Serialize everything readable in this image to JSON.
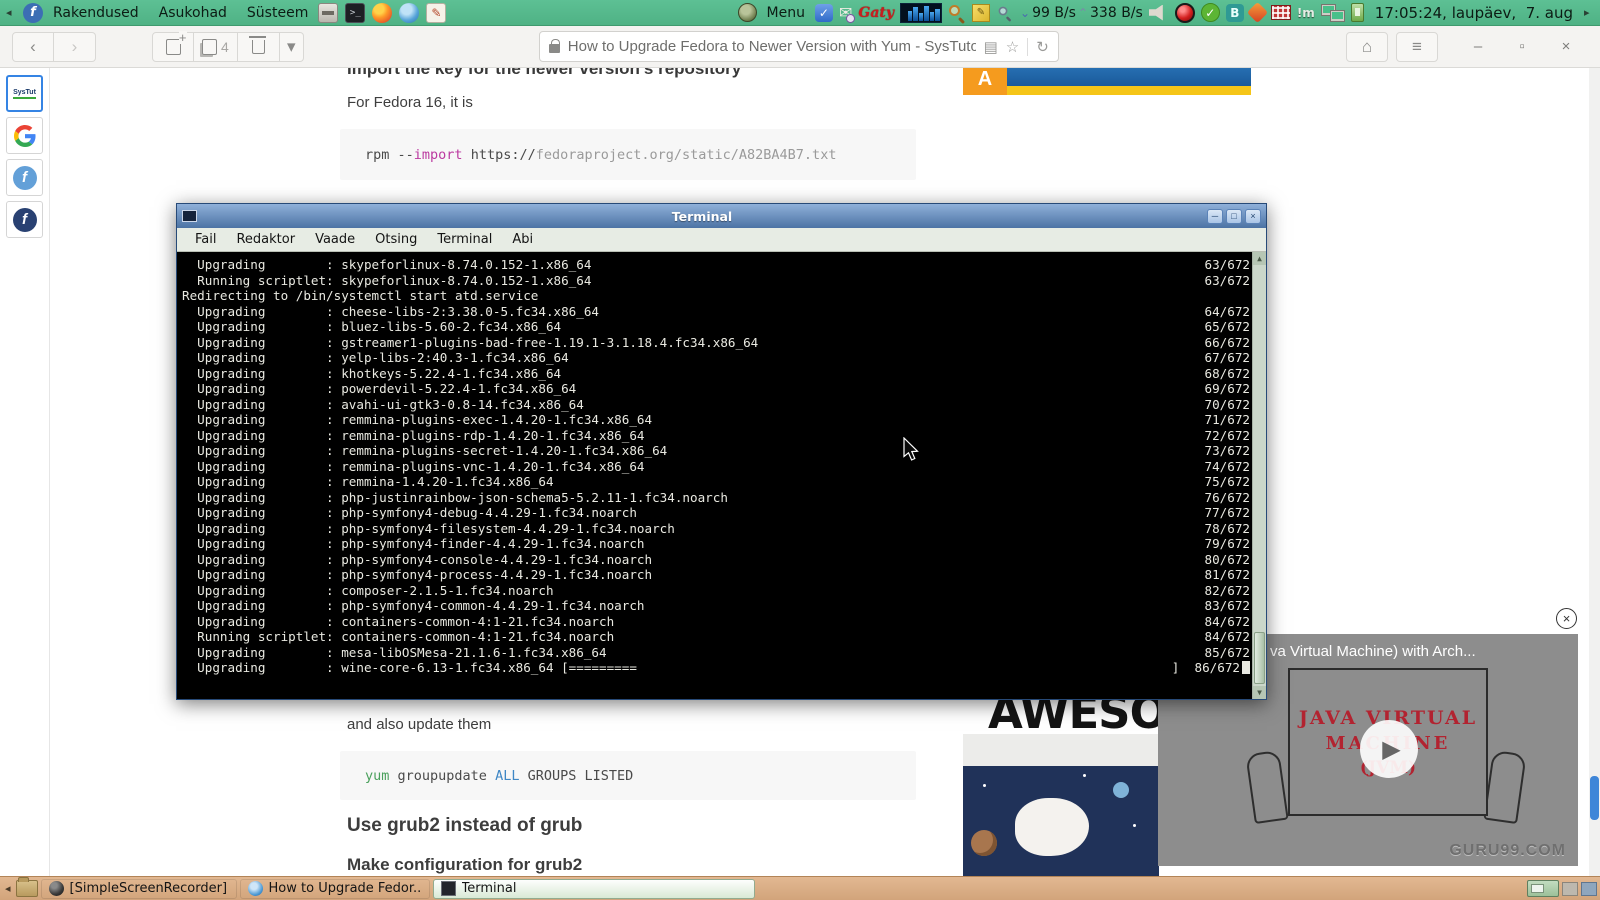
{
  "panel": {
    "menus": [
      {
        "name": "applications",
        "label": "Rakendused"
      },
      {
        "name": "places",
        "label": "Asukohad"
      },
      {
        "name": "system",
        "label": "Süsteem"
      }
    ],
    "menu_label": "Menu",
    "net_down": "99 B/s",
    "net_up": "338 B/s",
    "gaty_label": "Gaty",
    "im_label": "!m",
    "clock": "17:05:24, laupäev,  7. aug"
  },
  "icons": {
    "left_arrow": "◂",
    "right_arrow": "▸",
    "fedora_f": "f",
    "back": "‹",
    "forward": "›",
    "dropdown": "▾",
    "reader": "▤",
    "star": "☆",
    "reload": "↻",
    "home": "⌂",
    "hamburger": "≡",
    "minimize": "–",
    "maximize": "▫",
    "close": "×",
    "term_min": "─",
    "term_max": "□",
    "term_close": "×",
    "pencil": "✎",
    "check": "✓",
    "bluetooth": "B",
    "play": "▶",
    "overlay_close": "×",
    "terminal_prompt": ">_"
  },
  "browser": {
    "tab_count": "4",
    "url_text": "How to Upgrade Fedora to Newer Version with Yum - SysTutorials",
    "bookmark_systut": "SysTut",
    "bookmark_google": "Google",
    "fedora_letter": "f"
  },
  "page": {
    "heading_top": "Import the key for the newer version's repository",
    "para1": "For Fedora 16, it is",
    "code1": {
      "pre": "rpm --",
      "keyword": "import",
      "mid": " https://",
      "url": "fedoraproject.org/static/A82BA4B7.txt"
    },
    "banner_letter": "A",
    "para2": "and also update them",
    "code2": {
      "cmd": "yum",
      "mid": " groupupdate ",
      "arg": "ALL",
      "rest": " GROUPS LISTED"
    },
    "heading2": "Use grub2 instead of grub",
    "heading3": "Make configuration for grub2",
    "aside_text": "AWESOM",
    "video": {
      "title": "va Virtual Machine) with Arch...",
      "sign_line1": "JAVA VIRTUAL",
      "sign_line2": "MACHINE",
      "sign_line3": "(JVM)",
      "watermark": "GURU99.COM"
    }
  },
  "terminal": {
    "title": "Terminal",
    "menu": [
      "Fail",
      "Redaktor",
      "Vaade",
      "Otsing",
      "Terminal",
      "Abi"
    ],
    "lines": [
      {
        "l": "  Upgrading        : skypeforlinux-8.74.0.152-1.x86_64",
        "r": "63/672"
      },
      {
        "l": "  Running scriptlet: skypeforlinux-8.74.0.152-1.x86_64",
        "r": "63/672"
      },
      {
        "l": "Redirecting to /bin/systemctl start atd.service",
        "r": ""
      },
      {
        "l": "",
        "r": ""
      },
      {
        "l": "  Upgrading        : cheese-libs-2:3.38.0-5.fc34.x86_64",
        "r": "64/672"
      },
      {
        "l": "  Upgrading        : bluez-libs-5.60-2.fc34.x86_64",
        "r": "65/672"
      },
      {
        "l": "  Upgrading        : gstreamer1-plugins-bad-free-1.19.1-3.1.18.4.fc34.x86_64",
        "r": "66/672"
      },
      {
        "l": "  Upgrading        : yelp-libs-2:40.3-1.fc34.x86_64",
        "r": "67/672"
      },
      {
        "l": "  Upgrading        : khotkeys-5.22.4-1.fc34.x86_64",
        "r": "68/672"
      },
      {
        "l": "  Upgrading        : powerdevil-5.22.4-1.fc34.x86_64",
        "r": "69/672"
      },
      {
        "l": "  Upgrading        : avahi-ui-gtk3-0.8-14.fc34.x86_64",
        "r": "70/672"
      },
      {
        "l": "  Upgrading        : remmina-plugins-exec-1.4.20-1.fc34.x86_64",
        "r": "71/672"
      },
      {
        "l": "  Upgrading        : remmina-plugins-rdp-1.4.20-1.fc34.x86_64",
        "r": "72/672"
      },
      {
        "l": "  Upgrading        : remmina-plugins-secret-1.4.20-1.fc34.x86_64",
        "r": "73/672"
      },
      {
        "l": "  Upgrading        : remmina-plugins-vnc-1.4.20-1.fc34.x86_64",
        "r": "74/672"
      },
      {
        "l": "  Upgrading        : remmina-1.4.20-1.fc34.x86_64",
        "r": "75/672"
      },
      {
        "l": "  Upgrading        : php-justinrainbow-json-schema5-5.2.11-1.fc34.noarch",
        "r": "76/672"
      },
      {
        "l": "  Upgrading        : php-symfony4-debug-4.4.29-1.fc34.noarch",
        "r": "77/672"
      },
      {
        "l": "  Upgrading        : php-symfony4-filesystem-4.4.29-1.fc34.noarch",
        "r": "78/672"
      },
      {
        "l": "  Upgrading        : php-symfony4-finder-4.4.29-1.fc34.noarch",
        "r": "79/672"
      },
      {
        "l": "  Upgrading        : php-symfony4-console-4.4.29-1.fc34.noarch",
        "r": "80/672"
      },
      {
        "l": "  Upgrading        : php-symfony4-process-4.4.29-1.fc34.noarch",
        "r": "81/672"
      },
      {
        "l": "  Upgrading        : composer-2.1.5-1.fc34.noarch",
        "r": "82/672"
      },
      {
        "l": "  Upgrading        : php-symfony4-common-4.4.29-1.fc34.noarch",
        "r": "83/672"
      },
      {
        "l": "  Upgrading        : containers-common-4:1-21.fc34.noarch",
        "r": "84/672"
      },
      {
        "l": "  Running scriptlet: containers-common-4:1-21.fc34.noarch",
        "r": "84/672"
      },
      {
        "l": "  Upgrading        : mesa-libOSMesa-21.1.6-1.fc34.x86_64",
        "r": "85/672"
      },
      {
        "l": "  Upgrading        : wine-core-6.13-1.fc34.x86_64 [=========",
        "r": "]  86/672"
      }
    ]
  },
  "taskbar": {
    "items": [
      {
        "label": "[SimpleScreenRecorder]",
        "icon": "recorder",
        "active": false
      },
      {
        "label": "How to Upgrade Fedor...",
        "icon": "browser",
        "active": false
      },
      {
        "label": "Terminal",
        "icon": "terminal",
        "active": true
      }
    ]
  }
}
